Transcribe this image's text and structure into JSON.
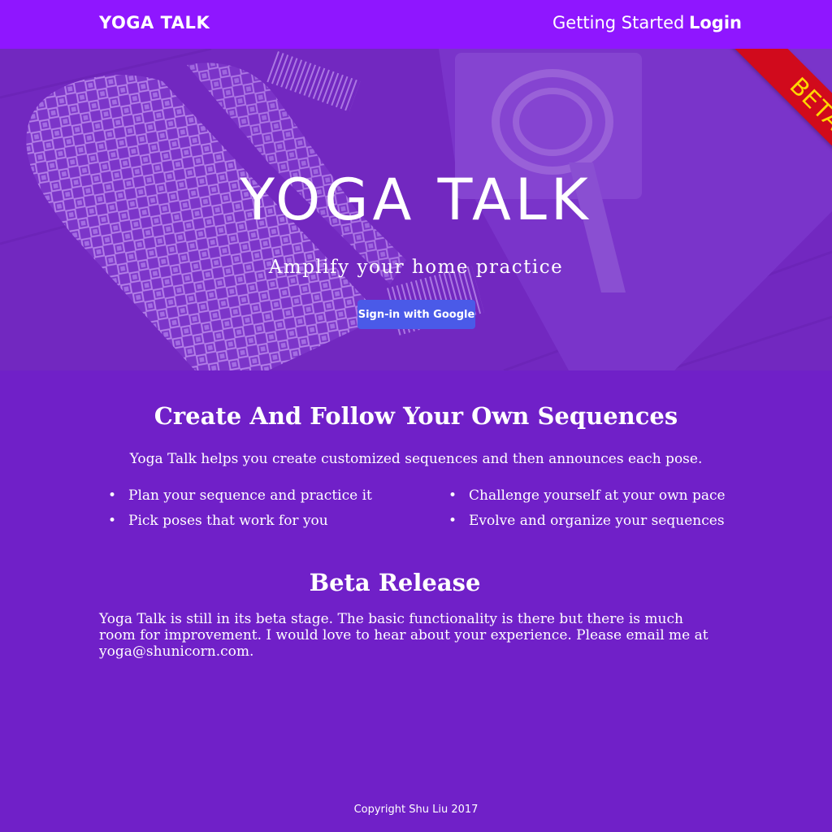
{
  "navbar": {
    "brand": "YOGA TALK",
    "links": [
      "Getting Started",
      "Login"
    ]
  },
  "hero": {
    "ribbon": "BETA",
    "title": "YOGA TALK",
    "subtitle": "Amplify your home practice",
    "button": "Sign-in with Google"
  },
  "sequences": {
    "title": "Create And Follow Your Own Sequences",
    "intro": "Yoga Talk helps you create customized sequences and then announces each pose.",
    "features_left": [
      "Plan your sequence and practice it",
      "Pick poses that work for you"
    ],
    "features_right": [
      "Challenge yourself at your own pace",
      "Evolve and organize your sequences"
    ]
  },
  "beta": {
    "title": "Beta Release",
    "text": "Yoga Talk is still in its beta stage. The basic functionality is there but there is much room for improvement. I would love to hear about your experience. Please email me at yoga@shunicorn.com."
  },
  "footer": "Copyright Shu Liu 2017",
  "colors": {
    "navbar": "#8f16ff",
    "background": "#7020c8",
    "ribbon": "#d10a1c",
    "ribbon_text": "#ffd900",
    "button": "#4a5ae8"
  },
  "icons": {
    "hero_image": "yoga-mat-and-strap-photo"
  }
}
